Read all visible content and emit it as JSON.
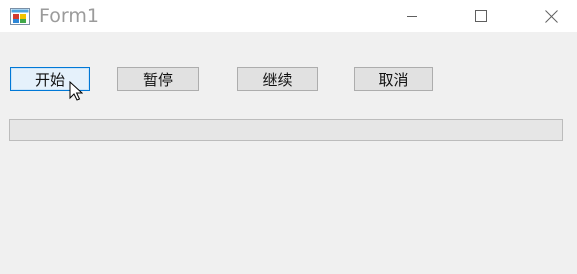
{
  "window": {
    "title": "Form1"
  },
  "controls": {
    "start_label": "开始",
    "pause_label": "暂停",
    "continue_label": "继续",
    "cancel_label": "取消"
  },
  "progress": {
    "value": 0
  },
  "icons": {
    "app": "windows-form-icon",
    "minimize": "minimize-icon",
    "maximize": "maximize-icon",
    "close": "close-icon",
    "cursor": "mouse-pointer-icon"
  },
  "colors": {
    "window_background": "#f0f0f0",
    "titlebar_background": "#ffffff",
    "focus_border": "#0078d7"
  }
}
